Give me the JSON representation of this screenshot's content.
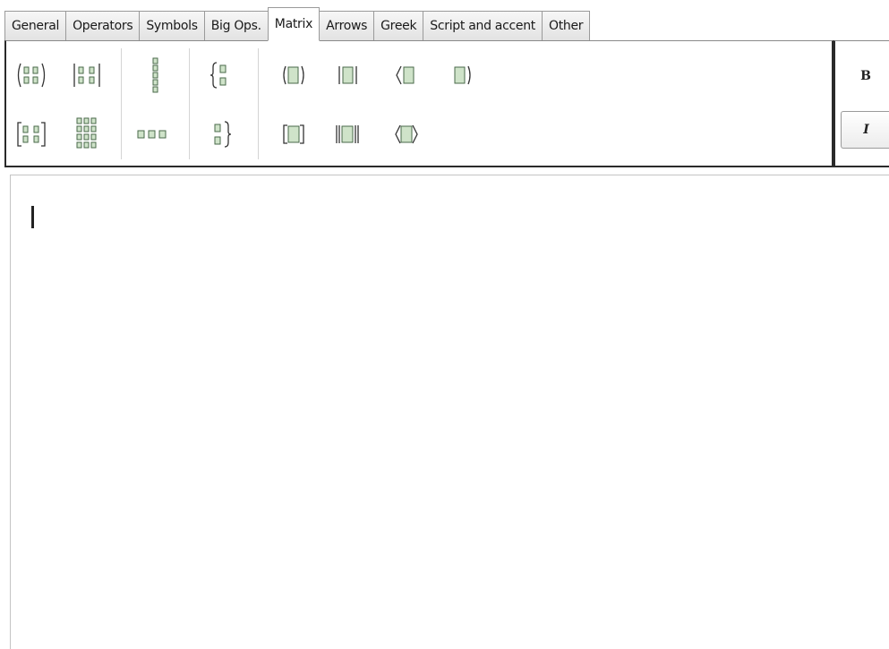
{
  "tabs": [
    {
      "label": "General"
    },
    {
      "label": "Operators"
    },
    {
      "label": "Symbols"
    },
    {
      "label": "Big Ops."
    },
    {
      "label": "Matrix",
      "active": true
    },
    {
      "label": "Arrows"
    },
    {
      "label": "Greek"
    },
    {
      "label": "Script and accent"
    },
    {
      "label": "Other"
    }
  ],
  "format_buttons": {
    "bold_label": "B",
    "italic_label": "I"
  },
  "matrix_buttons": [
    "matrix-2x2-parentheses-icon",
    "matrix-2x2-bars-icon",
    "column-vector-icon",
    "cases-left-brace-icon",
    "parentheses-wrap-icon",
    "bars-wrap-icon",
    "angle-wrap-icon",
    "right-paren-wrap-icon",
    "matrix-2x2-brackets-icon",
    "matrix-large-grid-icon",
    "row-vector-icon",
    "cases-right-brace-icon",
    "brackets-wrap-icon",
    "double-bars-wrap-icon",
    "angle-brackets-wrap-icon"
  ],
  "colors": {
    "slot_fill": "#cfe3c9",
    "slot_stroke": "#4a6a4a",
    "panel_border": "#2a2a2a"
  }
}
